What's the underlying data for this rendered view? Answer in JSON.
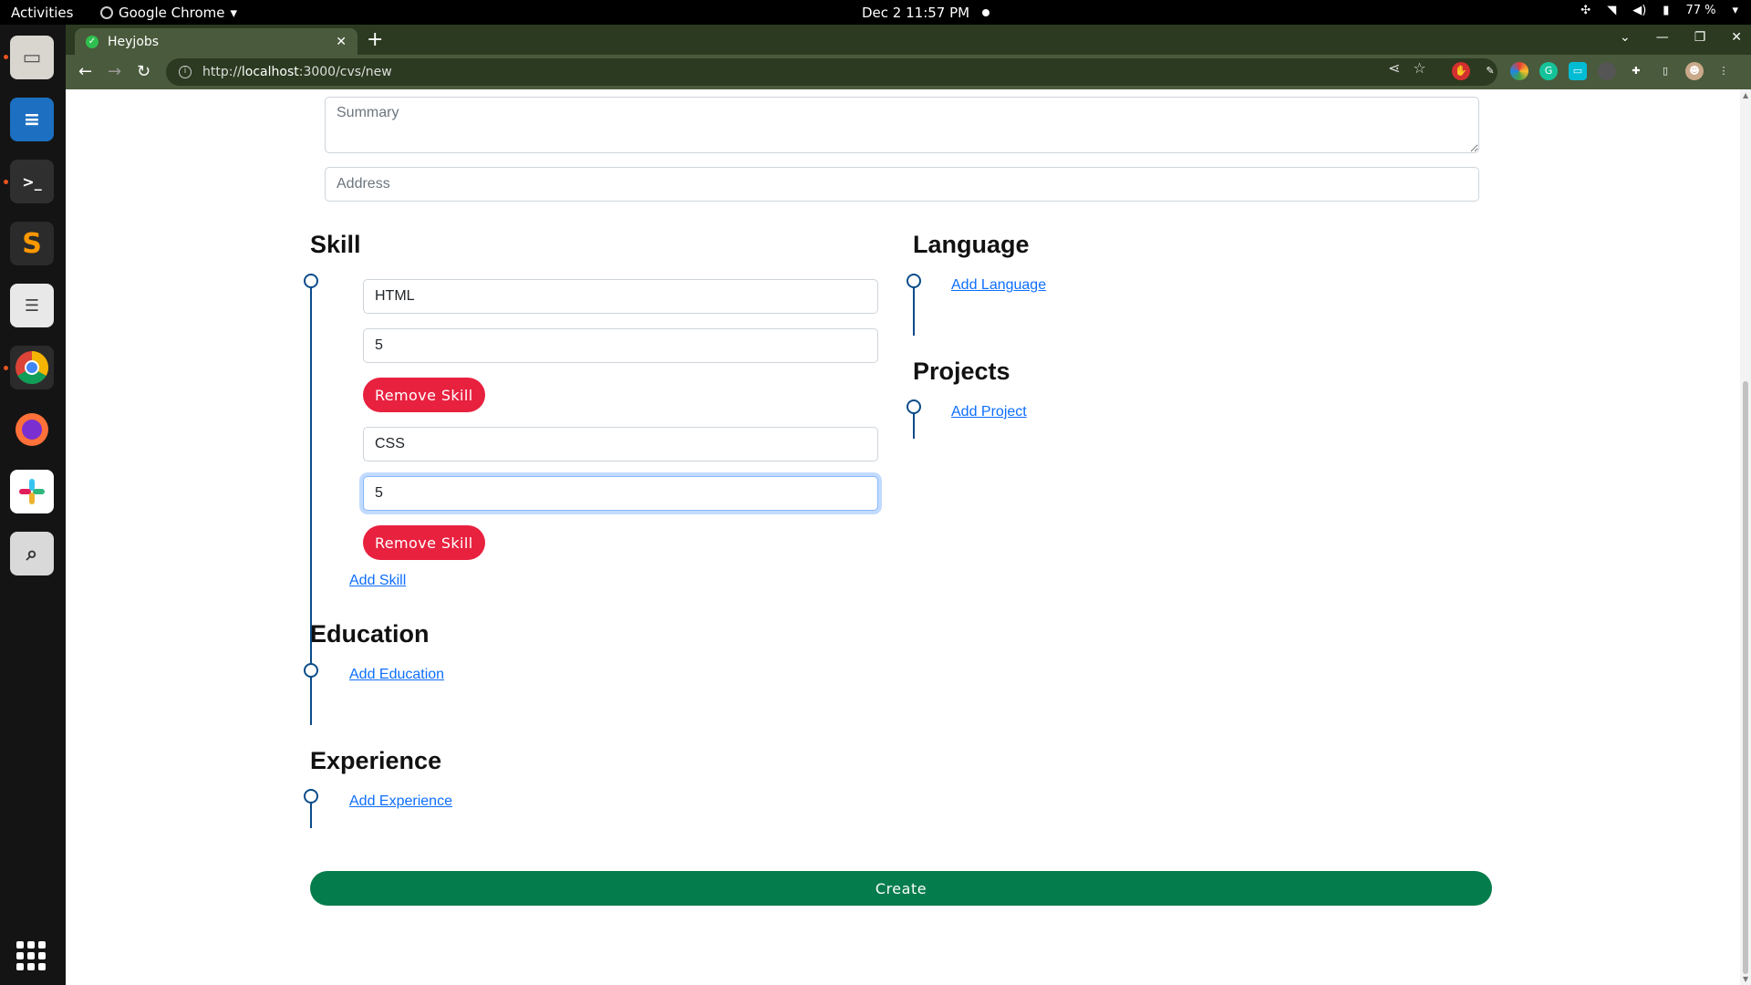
{
  "system": {
    "activities": "Activities",
    "app_name": "Google Chrome",
    "clock": "Dec 2  11:57 PM",
    "battery": "77 %"
  },
  "browser": {
    "tab_title": "Heyjobs",
    "url_scheme": "http://",
    "url_host": "localhost",
    "url_path": ":3000/cvs/new"
  },
  "form": {
    "summary_placeholder": "Summary",
    "address_placeholder": "Address",
    "skill": {
      "title": "Skill",
      "entries": [
        {
          "name": "HTML",
          "level": "5"
        },
        {
          "name": "CSS",
          "level": "5"
        }
      ],
      "remove_label": "Remove Skill",
      "add_label": "Add Skill"
    },
    "education": {
      "title": "Education",
      "add_label": "Add Education"
    },
    "experience": {
      "title": "Experience",
      "add_label": "Add Experience"
    },
    "language": {
      "title": "Language",
      "add_label": "Add Language"
    },
    "projects": {
      "title": "Projects",
      "add_label": "Add Project"
    },
    "create_label": "Create"
  },
  "colors": {
    "remove_button": "#e8213f",
    "create_button": "#057c4b",
    "timeline": "#0a4c8a",
    "link": "#0d6efd"
  }
}
